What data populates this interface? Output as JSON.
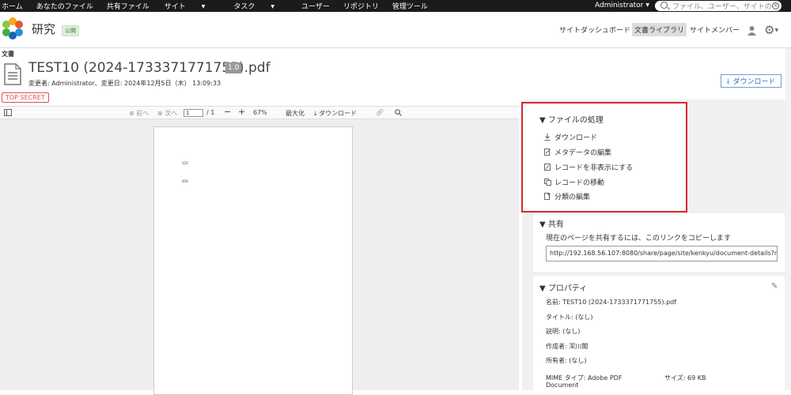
{
  "topbar": {
    "nav": [
      {
        "label": "ホーム",
        "caret": false
      },
      {
        "label": "あなたのファイル",
        "caret": false
      },
      {
        "label": "共有ファイル",
        "caret": false
      },
      {
        "label": "サイト",
        "caret": true
      },
      {
        "label": "タスク",
        "caret": true
      },
      {
        "label": "ユーザー",
        "caret": false
      },
      {
        "label": "リポジトリ",
        "caret": false
      },
      {
        "label": "管理ツール",
        "caret": false
      }
    ],
    "user": "Administrator",
    "search_placeholder": "ファイル、ユーザー、サイトの"
  },
  "site": {
    "name": "研究",
    "badge": "公開",
    "nav": {
      "dashboard": "サイトダッシュボード",
      "library": "文書ライブラリ",
      "members": "サイトメンバー"
    }
  },
  "document": {
    "section_label": "文書",
    "title": "TEST10 (2024-1733371771755).pdf",
    "version": "1.0",
    "modified": "変更者: Administrator、変更日: 2024年12月5日（木） 13:09:33",
    "download_label": "ダウンロード",
    "tag": "TOP SECRET"
  },
  "viewer": {
    "prev": "前へ",
    "next": "次へ",
    "page_value": "1",
    "page_total": "/ 1",
    "zoom": "67%",
    "maximize": "最大化",
    "download": "ダウンロード",
    "page_text": [
      "123",
      "456"
    ]
  },
  "actions": {
    "title": "▼ ファイルの処理",
    "items": [
      "ダウンロード",
      "メタデータの編集",
      "レコードを非表示にする",
      "レコードの移動",
      "分類の編集"
    ]
  },
  "share": {
    "title": "▼ 共有",
    "text": "現在のページを共有するには、このリンクをコピーします",
    "link": "http://192.168.56.107:8080/share/page/site/kenkyu/document-details?nod"
  },
  "properties": {
    "title": "▼ プロパティ",
    "name": "名前:  TEST10 (2024-1733371771755).pdf",
    "doc_title": "タイトル:  (なし)",
    "description": "説明:  (なし)",
    "creator": "作成者:  潔川聞",
    "owner": "所有者:  (なし)",
    "mime_label": "MIME タイプ:  Adobe PDF",
    "mime_cont": "Document",
    "size": "サイズ:  69 KB"
  },
  "colors": {
    "topbar": "#1b1b1b",
    "highlight": "#d8262e",
    "tag": "#d9534f",
    "link": "#2f6fb5"
  }
}
